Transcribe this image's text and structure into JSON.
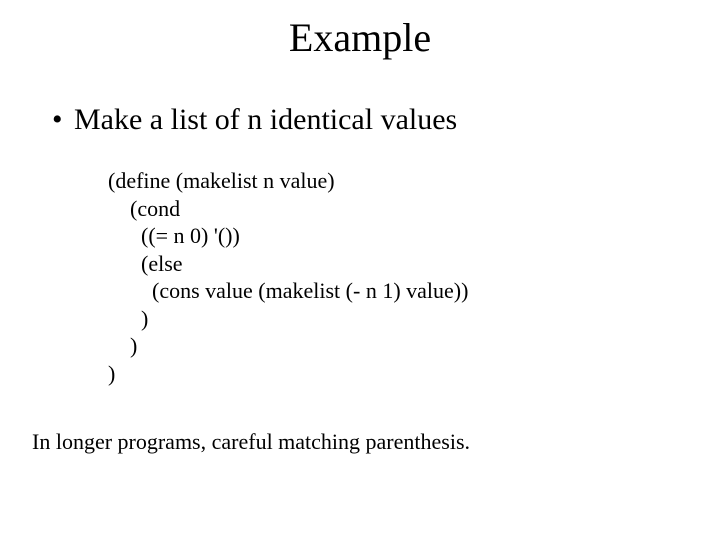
{
  "title": "Example",
  "bullet": {
    "marker": "•",
    "text": "Make a list of n identical values"
  },
  "code": {
    "l1": "(define (makelist n value)",
    "l2": "    (cond",
    "l3": "      ((= n 0) '())",
    "l4": "      (else",
    "l5": "        (cons value (makelist (- n 1) value))",
    "l6": "      )",
    "l7": "    )",
    "l8": ")"
  },
  "footer": "In longer programs, careful matching parenthesis."
}
